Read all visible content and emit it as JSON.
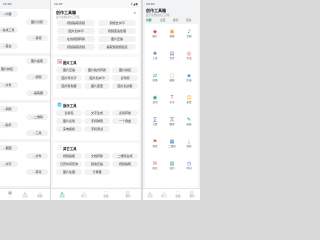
{
  "status": {
    "time": "12:07",
    "indicators": "▾◢▮"
  },
  "screen1": {
    "chips": [
      "…内容",
      "图片识别",
      "…在线工具",
      "…音频",
      "…变白",
      "图片提取",
      "图片拼接",
      "…视频",
      "…文件",
      "…提取器",
      "…视频",
      "…二维码",
      "…助手",
      "…工具",
      "…报图",
      "…文件",
      "…文字",
      "…转化"
    ],
    "tabs": [
      "…",
      "首页",
      "收藏",
      "我的"
    ]
  },
  "screen2": {
    "app_title": "创作工具箱",
    "subtitle": "最全最便捷的工具箱",
    "top_chips": [
      "视频提取音频",
      "视频去水印",
      "图片加水印",
      "视频变速处理",
      "在线视频转换",
      "图片压缩",
      "视频提取音频",
      "提取短视频链接"
    ],
    "sections": [
      {
        "title": "图片工具",
        "icon": "🖼",
        "color": "#e55353",
        "chips": [
          "图片压缩",
          "图片格式转换",
          "图片拼接",
          "图片转文字",
          "图片加水印",
          "证件照",
          "图片取色器",
          "图片变更",
          "图片加边框"
        ]
      },
      {
        "title": "娱乐工具",
        "icon": "🌐",
        "color": "#3a7bd5",
        "chips": [
          "表情包",
          "文字生成",
          "表情转换",
          "图片表情",
          "手持弹幕",
          "一个键盘",
          "来电模拟",
          "手机测试"
        ]
      },
      {
        "title": "其它工具",
        "icon": "📄",
        "color": "#d64fb5",
        "chips": [
          "视频提取",
          "文档转换",
          "二维码生成",
          "日历时间查询",
          "短信压缩",
          "视频编辑",
          "图片处理",
          "计算器"
        ]
      }
    ],
    "tabs": [
      "首页",
      "热门",
      "收藏",
      "我的"
    ]
  },
  "screen3": {
    "title": "创作工具箱",
    "subtitle": "最全最便捷的工具箱",
    "tabs": [
      "功能",
      "设置",
      "推荐",
      "更多"
    ],
    "grid": [
      {
        "label": "图片",
        "icon": "◆",
        "color": "#e5533d"
      },
      {
        "label": "视频",
        "icon": "▣",
        "color": "#f0a020"
      },
      {
        "label": "音频",
        "icon": "♪",
        "color": "#1aa260"
      },
      {
        "label": "工具",
        "icon": "✚",
        "color": "#3a7bd5"
      },
      {
        "label": "文件",
        "icon": "▤",
        "color": "#9b59b6"
      },
      {
        "label": "生成",
        "icon": "◎",
        "color": "#e5533d"
      },
      {
        "label": "转换",
        "icon": "⇄",
        "color": "#1aa260"
      },
      {
        "label": "截屏",
        "icon": "▢",
        "color": "#f0a020"
      },
      {
        "label": "压缩",
        "icon": "◈",
        "color": "#3a7bd5"
      },
      {
        "label": "识别",
        "icon": "◉",
        "color": "#1aa260"
      },
      {
        "label": "文字",
        "icon": "T",
        "color": "#e5533d"
      },
      {
        "label": "表情",
        "icon": "☺",
        "color": "#f0a020"
      },
      {
        "label": "计算",
        "icon": "∑",
        "color": "#3a7bd5"
      },
      {
        "label": "翻译",
        "icon": "文",
        "color": "#9b59b6"
      },
      {
        "label": "画板",
        "icon": "✎",
        "color": "#1aa260"
      },
      {
        "label": "测试",
        "icon": "⚑",
        "color": "#e5533d"
      },
      {
        "label": "二维码",
        "icon": "▦",
        "color": "#3a7bd5"
      },
      {
        "label": "提取",
        "icon": "⤓",
        "color": "#f0a020"
      },
      {
        "label": "短信",
        "icon": "✉",
        "color": "#e5533d"
      },
      {
        "label": "日历",
        "icon": "▥",
        "color": "#1aa260"
      },
      {
        "label": "时间",
        "icon": "◷",
        "color": "#3a7bd5"
      }
    ],
    "bottom_tabs": [
      "首页",
      "热门",
      "收藏",
      "我的"
    ]
  }
}
